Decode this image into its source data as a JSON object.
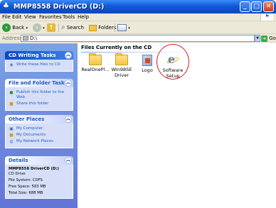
{
  "window": {
    "title": "MMP8558 DriverCD (D:)"
  },
  "menubar": {
    "items": [
      "File",
      "Edit",
      "View",
      "Favorites",
      "Tools",
      "Help"
    ]
  },
  "toolbar": {
    "back_label": "Back",
    "search_label": "Search",
    "folders_label": "Folders"
  },
  "address": {
    "label": "Address",
    "value": "D:\\",
    "go_label": "Go"
  },
  "taskpane": {
    "cd_writing": {
      "title": "CD Writing Tasks",
      "tasks": [
        "Write these files to CD"
      ]
    },
    "file_folder": {
      "title": "File and Folder Tasks",
      "tasks": [
        "Publish this folder to the Web",
        "Share this folder"
      ]
    },
    "other_places": {
      "title": "Other Places",
      "tasks": [
        "My Computer",
        "My Documents",
        "My Network Places"
      ]
    },
    "details": {
      "title": "Details",
      "name": "MMP8558 DriverCD (D:)",
      "type": "CD Drive",
      "file_system": "File System: CDFS",
      "free_space": "Free Space: 583 MB",
      "total_size": "Total Size: 688 MB"
    }
  },
  "content": {
    "group_title": "Files Currently on the CD",
    "items": [
      {
        "label": "RealOnePl...",
        "icon": "folder-icon"
      },
      {
        "label": "Win98SE Driver",
        "icon": "folder-icon"
      },
      {
        "label": "Logo",
        "icon": "image-file-icon"
      },
      {
        "label": "Software Setup",
        "icon": "setup-icon"
      }
    ]
  },
  "colors": {
    "titlebar": "#0a46c4",
    "taskpane": "#7ba2e7",
    "link": "#215dc6",
    "highlight": "#d6262a"
  }
}
